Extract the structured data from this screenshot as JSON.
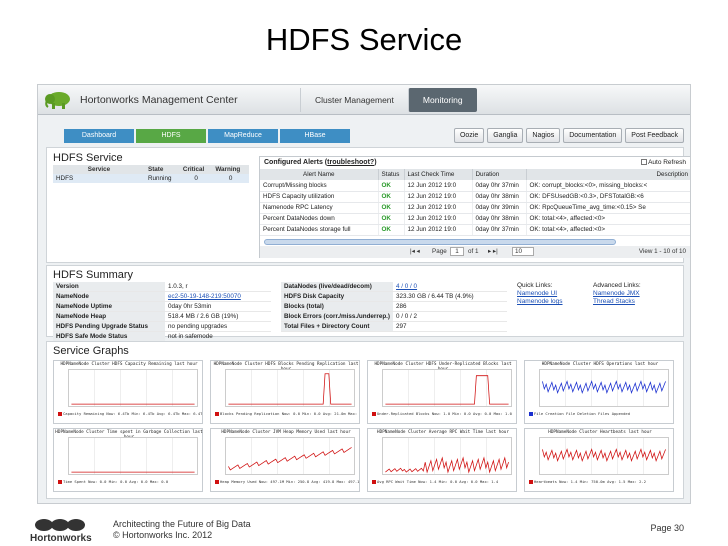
{
  "slide": {
    "title": "HDFS Service",
    "footer_line1": "Architecting the Future of Big Data",
    "footer_line2": "© Hortonworks Inc. 2012",
    "page": "Page 30",
    "logo_text": "Hortonworks"
  },
  "header": {
    "brand": "Hortonworks Management Center",
    "nav": [
      "Cluster Management",
      "Monitoring"
    ],
    "active_nav": "Monitoring"
  },
  "tabs": [
    "Dashboard",
    "HDFS",
    "MapReduce",
    "HBase"
  ],
  "active_tab": "HDFS",
  "tool_buttons": [
    "Oozie",
    "Ganglia",
    "Nagios",
    "Documentation",
    "Post Feedback"
  ],
  "hdfs_service": {
    "title": "HDFS Service",
    "columns": [
      "Service",
      "State",
      "Critical",
      "Warning"
    ],
    "row": [
      "HDFS",
      "Running",
      "0",
      "0"
    ]
  },
  "alerts": {
    "title_prefix": "Configured Alerts (",
    "title_link": "troubleshoot?",
    "title_suffix": ")",
    "auto_refresh": "Auto Refresh",
    "columns": [
      "Alert Name",
      "Status",
      "Last Check Time",
      "Duration",
      "Description"
    ],
    "rows": [
      [
        "Corrupt/Missing blocks",
        "OK",
        "12 Jun 2012 19:0",
        "0day 0hr 37min",
        "OK: corrupt_blocks:<0>, missing_blocks:<"
      ],
      [
        "HDFS Capacity utilization",
        "OK",
        "12 Jun 2012 19:0",
        "0day 0hr 38min",
        "OK: DFSUsedGB:<0.3>, DFSTotalGB:<6"
      ],
      [
        "Namenode RPC Latency",
        "OK",
        "12 Jun 2012 19:0",
        "0day 0hr 39min",
        "OK: RpcQueueTime_avg_time:<0.15> Se"
      ],
      [
        "Percent DataNodes down",
        "OK",
        "12 Jun 2012 19:0",
        "0day 0hr 38min",
        "OK: total:<4>, affected:<0>"
      ],
      [
        "Percent DataNodes storage full",
        "OK",
        "12 Jun 2012 19:0",
        "0day 0hr 37min",
        "OK: total:<4>, affected:<0>"
      ]
    ],
    "pager_page_label": "Page",
    "pager_page": "1",
    "pager_of": "of 1",
    "pager_size": "10",
    "view_text": "View 1 - 10 of 10"
  },
  "summary": {
    "title": "HDFS Summary",
    "left": [
      [
        "Version",
        "1.0.3, r"
      ],
      [
        "NameNode",
        "ec2-50-19-148-219:50070"
      ],
      [
        "NameNode Uptime",
        "0day 0hr 53min"
      ],
      [
        "NameNode Heap",
        "518.4 MB / 2.6 GB (19%)"
      ],
      [
        "HDFS Pending Upgrade Status",
        "no pending upgrades"
      ],
      [
        "HDFS Safe Mode Status",
        "not in safemode"
      ]
    ],
    "middle": [
      [
        "DataNodes (live/dead/decom)",
        "4 / 0 / 0"
      ],
      [
        "HDFS Disk Capacity",
        "323.30 GB / 6.44 TB (4.9%)"
      ],
      [
        "Blocks (total)",
        "286"
      ],
      [
        "Block Errors (corr./miss./underrep.)",
        "0 / 0 / 2"
      ],
      [
        "Total Files + Directory Count",
        "297"
      ]
    ],
    "quick_links_title": "Quick Links:",
    "quick_links": [
      "Namenode UI",
      "Namenode logs"
    ],
    "advanced_links_title": "Advanced Links:",
    "advanced_links": [
      "Namenode JMX",
      "Thread Stacks"
    ]
  },
  "graphs": {
    "title": "Service Graphs",
    "items": [
      {
        "title": "HDPNameNode Cluster HDFS Capacity Remaining last hour",
        "legend": "Capacity Remaining  Now: 6.4Tb  Min: 6.4Tb  Avg: 6.4Tb  Max: 6.4Tb",
        "color": "#d01010"
      },
      {
        "title": "HDPNameNode Cluster HDFS Blocks Pending Replication last hour",
        "legend": "Blocks Pending Replication  Now: 0.0  Min: 0.0  Avg: 21.0m  Max: 302.0m",
        "color": "#d01010"
      },
      {
        "title": "HDPNameNode Cluster HDFS Under-Replicated Blocks last hour",
        "legend": "Under-Replicated Blocks  Now: 1.0  Min: 0.0  Avg: 0.0  Max: 1.0",
        "color": "#d01010"
      },
      {
        "title": "HDPNameNode Cluster HDFS Operations last hour",
        "legend": "File Creation  File Deletion  Files Appended",
        "color": "#1a2fd0"
      },
      {
        "title": "HDPNameNode Cluster Time spent in Garbage Collection last hour",
        "legend": "Time Spent  Now: 0.0  Min: 0.0  Avg: 0.0  Max: 0.0",
        "color": "#d01010"
      },
      {
        "title": "HDPNameNode Cluster JVM Heap Memory Used last hour",
        "legend": "Heap Memory Used  Now: 497.1M  Min: 250.8  Avg: 419.8  Max: 497.1M",
        "color": "#d01010"
      },
      {
        "title": "HDPNameNode Cluster Average RPC Wait Time last hour",
        "legend": "Avg RPC Wait Time  Now: 1.4  Min: 0.0  Avg: 0.0  Max: 1.4",
        "color": "#d01010"
      },
      {
        "title": "HDPNameNode Cluster Heartbeats last hour",
        "legend": "Heartbeats  Now: 1.4  Min: 750.0m  Avg: 1.5  Max: 2.2",
        "color": "#d01010"
      }
    ]
  }
}
